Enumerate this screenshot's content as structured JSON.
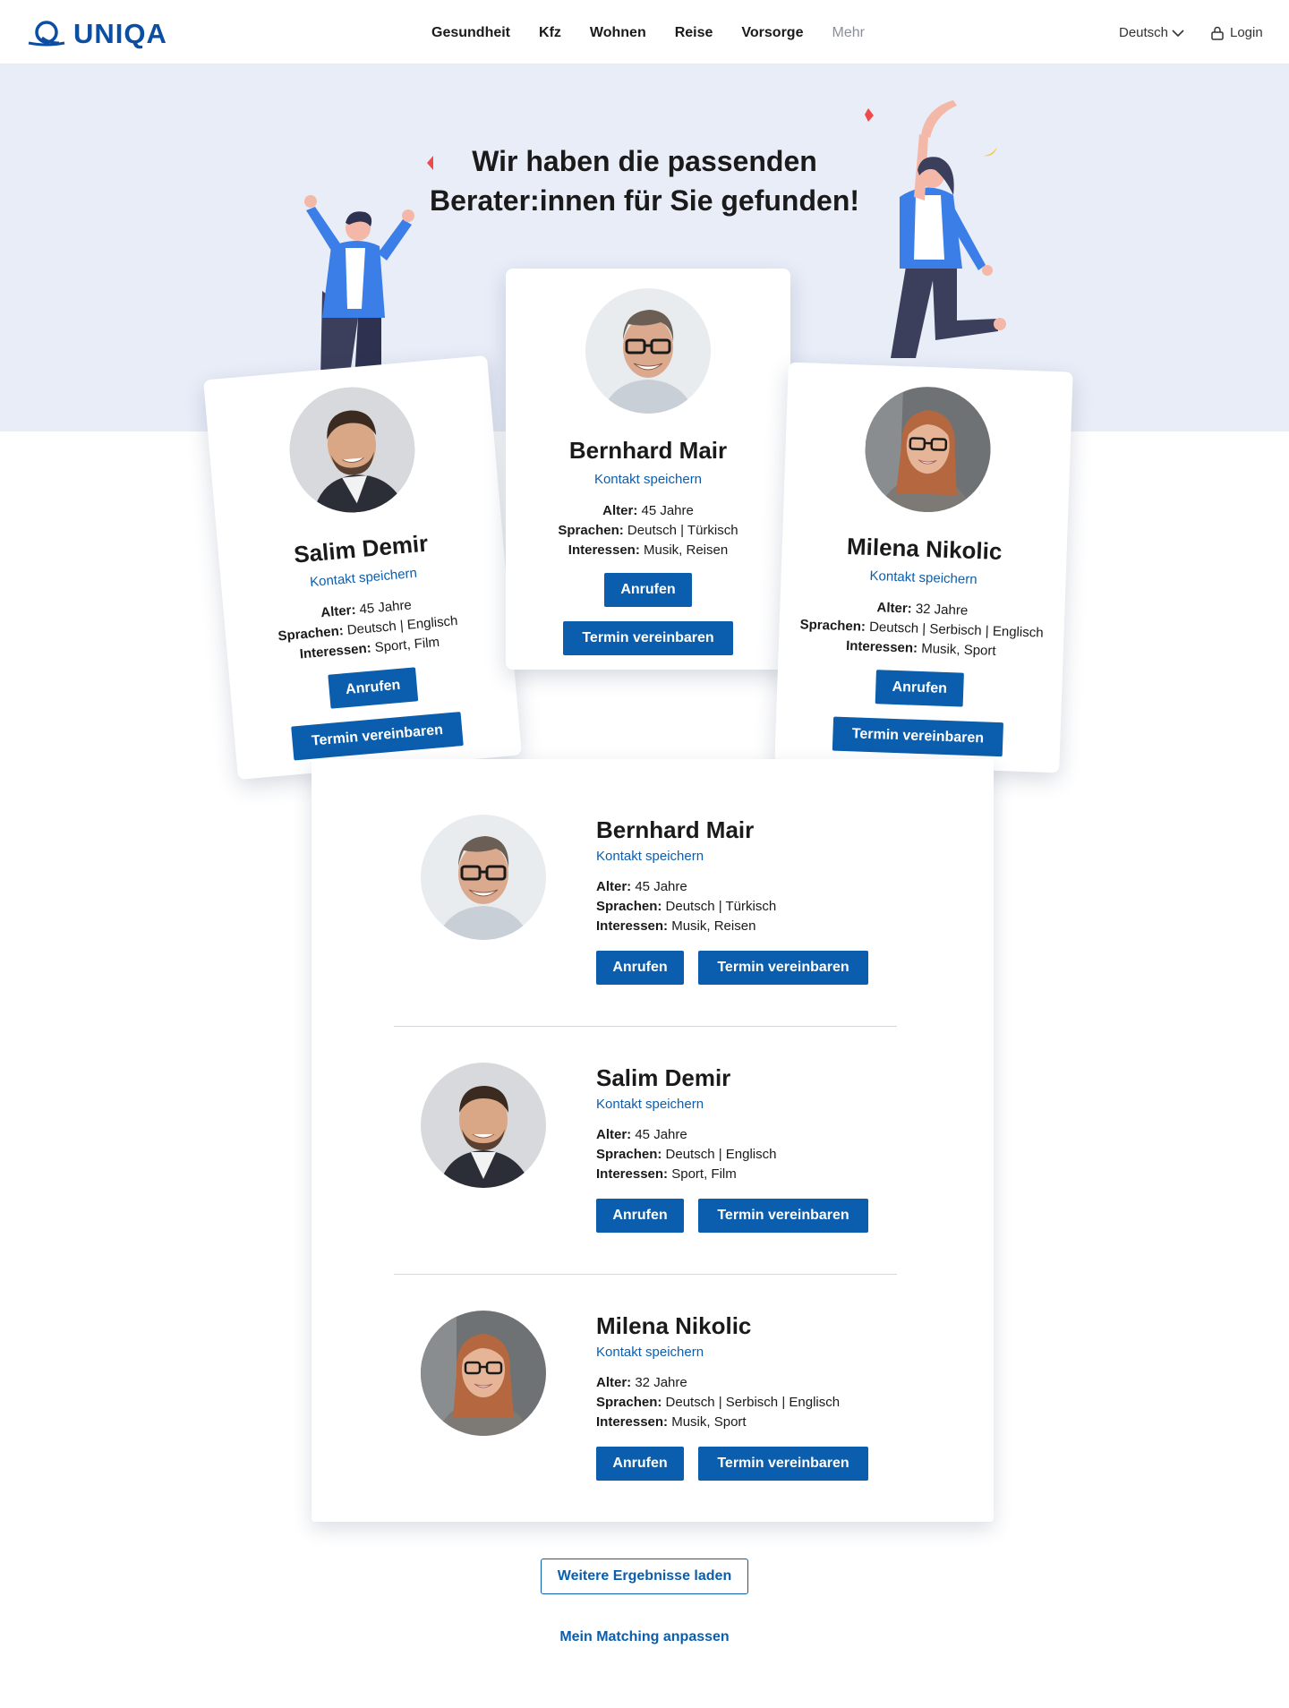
{
  "header": {
    "brand": "UNIQA",
    "nav": [
      "Gesundheit",
      "Kfz",
      "Wohnen",
      "Reise",
      "Vorsorge",
      "Mehr"
    ],
    "language": "Deutsch",
    "login": "Login"
  },
  "hero": {
    "title_line1": "Wir haben die passenden",
    "title_line2": "Berater:innen für Sie gefunden!"
  },
  "labels": {
    "age": "Alter:",
    "languages": "Sprachen:",
    "interests": "Interessen:",
    "save_contact": "Kontakt speichern",
    "call": "Anrufen",
    "appointment": "Termin vereinbaren"
  },
  "featured": [
    {
      "name": "Salim Demir",
      "age": "45 Jahre",
      "languages": "Deutsch | Englisch",
      "interests": "Sport, Film"
    },
    {
      "name": "Bernhard Mair",
      "age": "45 Jahre",
      "languages": "Deutsch | Türkisch",
      "interests": "Musik, Reisen"
    },
    {
      "name": "Milena Nikolic",
      "age": "32 Jahre",
      "languages": "Deutsch | Serbisch | Englisch",
      "interests": "Musik, Sport"
    }
  ],
  "list": [
    {
      "name": "Bernhard Mair",
      "age": "45 Jahre",
      "languages": "Deutsch | Türkisch",
      "interests": "Musik, Reisen"
    },
    {
      "name": "Salim Demir",
      "age": "45 Jahre",
      "languages": "Deutsch | Englisch",
      "interests": "Sport, Film"
    },
    {
      "name": "Milena Nikolic",
      "age": "32 Jahre",
      "languages": "Deutsch | Serbisch | Englisch",
      "interests": "Musik, Sport"
    }
  ],
  "footer": {
    "load_more": "Weitere Ergebnisse laden",
    "adjust_matching": "Mein Matching anpassen"
  },
  "colors": {
    "primary": "#0b5ead",
    "hero_bg": "#e9edf8",
    "accent_red": "#ef4a4a",
    "accent_yellow": "#f5c518"
  },
  "icons": [
    "uniqa-logo-icon",
    "chevron-down-icon",
    "lock-icon"
  ]
}
